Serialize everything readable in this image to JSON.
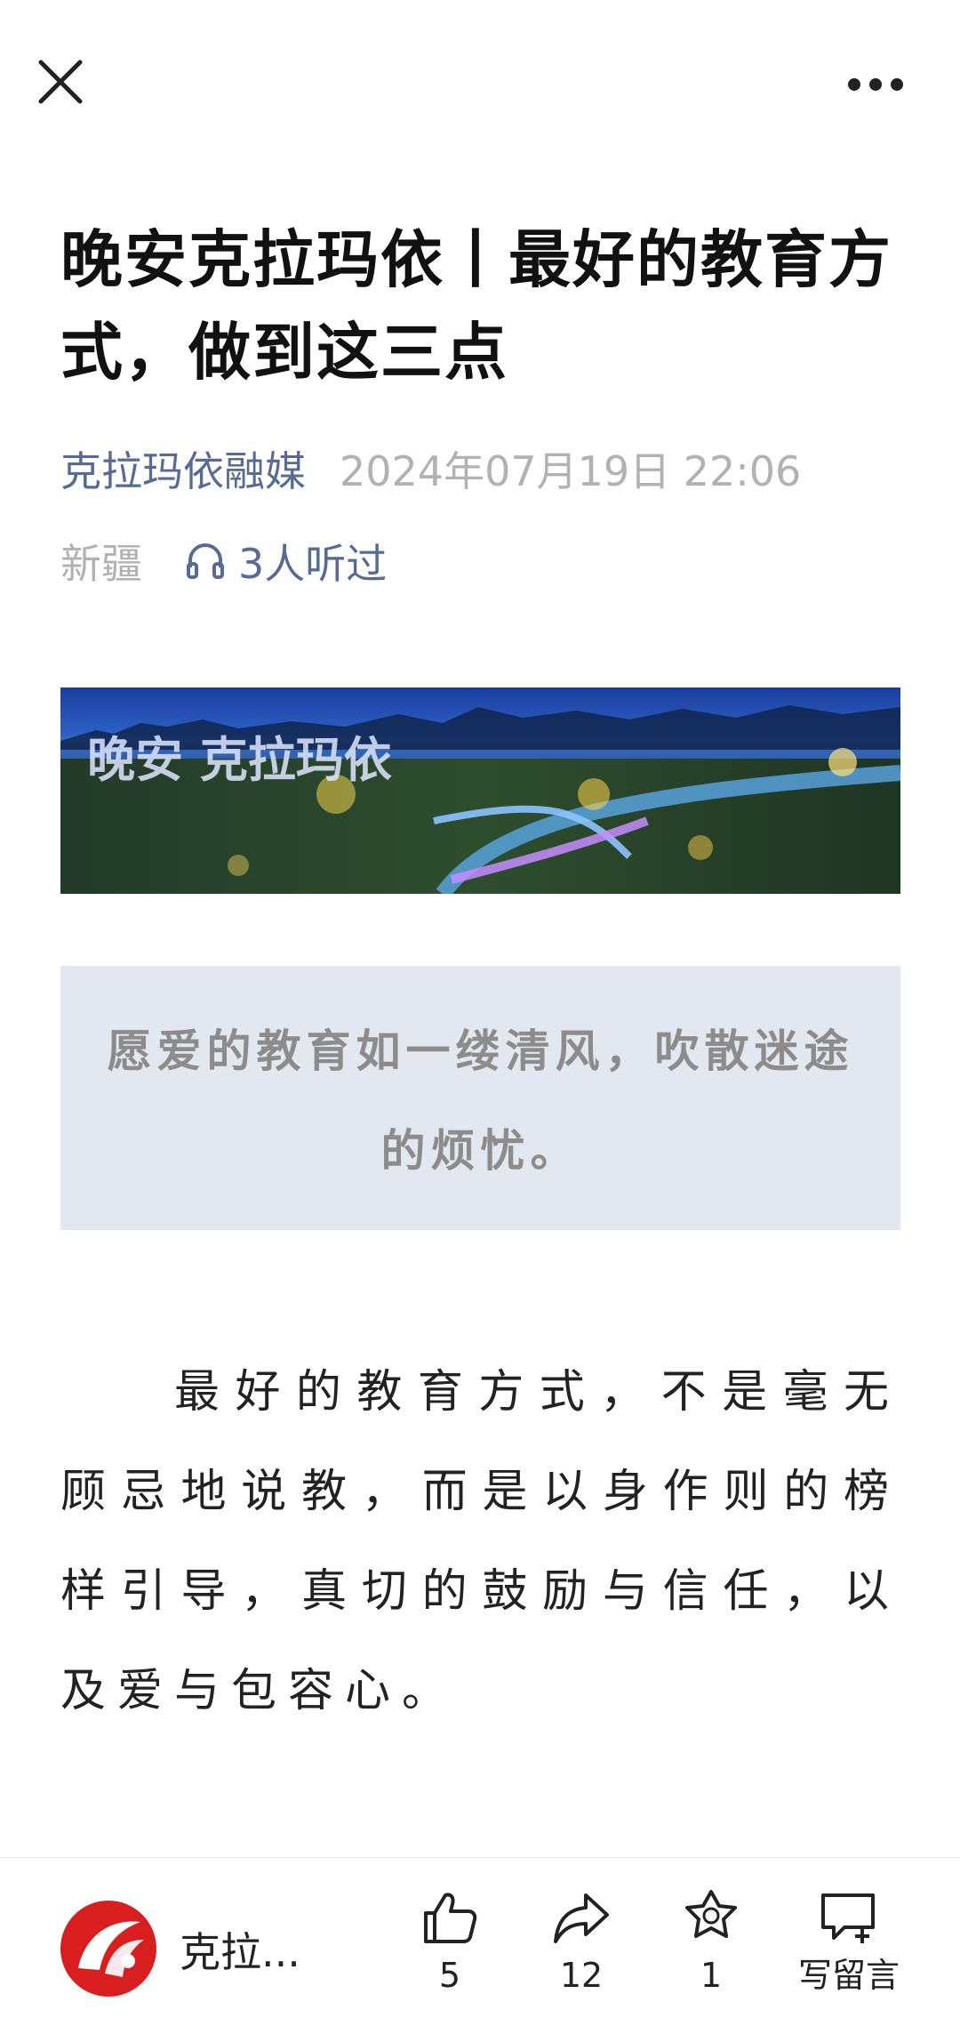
{
  "article": {
    "title": "晚安克拉玛依丨最好的教育方式，做到这三点",
    "author": "克拉玛依融媒",
    "date": "2024年07月19日 22:06",
    "region": "新疆",
    "listen_count": "3人听过",
    "banner_text": "晚安 克拉玛依",
    "quote": "愿爱的教育如一缕清风，吹散迷途的烦忧。",
    "paragraph": "最好的教育方式，不是毫无顾忌地说教，而是以身作则的榜样引导，真切的鼓励与信任，以及爱与包容心。"
  },
  "bottom_bar": {
    "channel_name": "克拉...",
    "like_count": "5",
    "share_count": "12",
    "favorite_count": "1",
    "comment_label": "写留言"
  },
  "icons": {
    "close": "close-icon",
    "more": "more-icon",
    "headphones": "headphones-icon",
    "like": "thumbs-up-icon",
    "share": "share-arrow-icon",
    "favorite": "star-icon",
    "comment": "comment-icon"
  },
  "colors": {
    "link_blue": "#576b95",
    "meta_gray": "#b2b2b2",
    "quote_bg": "#e3e7ef",
    "logo_red": "#d81e1e"
  }
}
